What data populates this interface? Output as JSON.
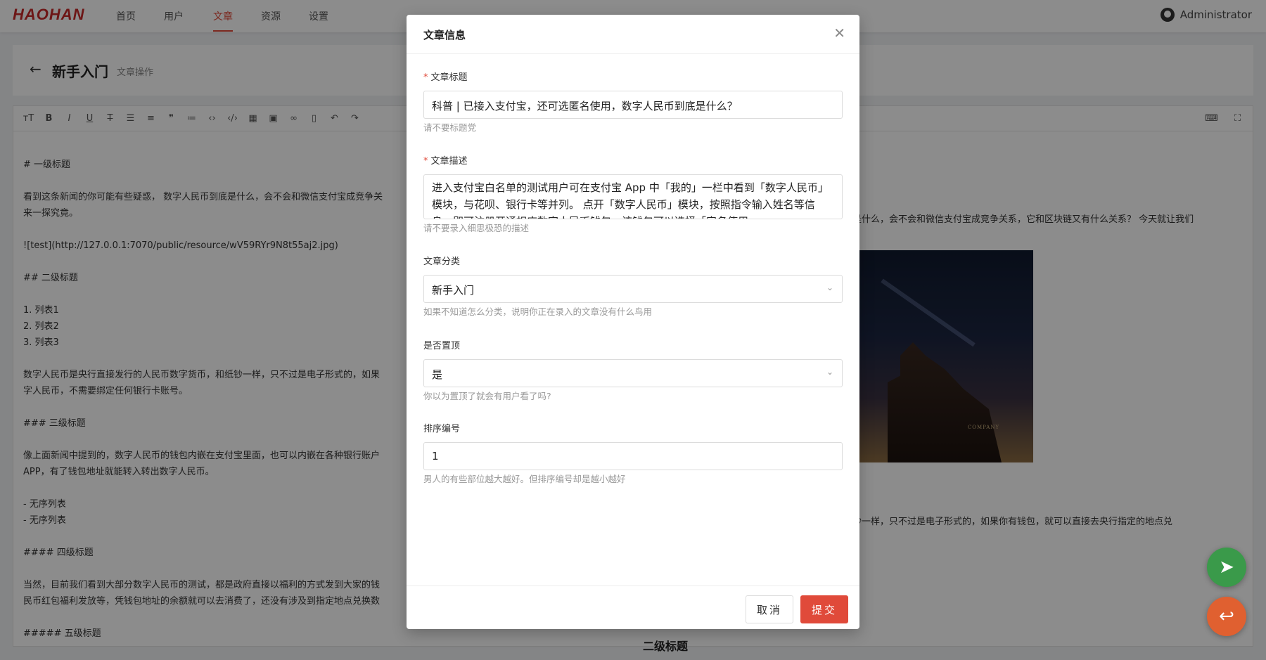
{
  "navbar": {
    "logo": "HAOHAN",
    "items": [
      {
        "label": "首页"
      },
      {
        "label": "用户"
      },
      {
        "label": "文章"
      },
      {
        "label": "资源"
      },
      {
        "label": "设置"
      }
    ],
    "active_index": 2,
    "user_name": "Administrator"
  },
  "page_header": {
    "title": "新手入门",
    "subtitle": "文章操作"
  },
  "editor": {
    "toolbar": [
      "heading-icon",
      "bold-icon",
      "italic-icon",
      "underline-icon",
      "strikethrough-icon",
      "unordered-list-icon",
      "ordered-list-icon",
      "quote-icon",
      "hr-icon",
      "code-icon",
      "code-block-icon",
      "table-icon",
      "image-icon",
      "link-icon",
      "trash-icon",
      "undo-icon",
      "redo-icon"
    ],
    "markdown_lines": [
      "# 一级标题",
      "",
      "看到这条新闻的你可能有些疑惑， 数字人民币到底是什么，会不会和微信支付宝成竞争关",
      "来一探究竟。",
      "",
      "![test](http://127.0.0.1:7070/public/resource/wV59RYr9N8t55aj2.jpg)",
      "",
      "## 二级标题",
      "",
      "1. 列表1",
      "2. 列表2",
      "3. 列表3",
      "",
      "数字人民币是央行直接发行的人民币数字货币，和纸钞一样，只不过是电子形式的，如果",
      "字人民币，不需要绑定任何银行卡账号。",
      "",
      "### 三级标题",
      "",
      "像上面新闻中提到的，数字人民币的钱包内嵌在支付宝里面，也可以内嵌在各种银行账户",
      "APP，有了钱包地址就能转入转出数字人民币。",
      "",
      "- 无序列表",
      "- 无序列表",
      "",
      "#### 四级标题",
      "",
      "当然，目前我们看到大部分数字人民币的测试，都是政府直接以福利的方式发到大家的钱",
      "民币红包福利发放等，凭钱包地址的余额就可以去消费了，还没有涉及到指定地点兑换数",
      "",
      "##### 五级标题"
    ],
    "preview_line_1": "底是什么，会不会和微信支付宝成竞争关系，它和区块链又有什么关系？ 今天就让我们",
    "preview_line_2": "纸钞一样，只不过是电子形式的，如果你有钱包，就可以直接去央行指定的地点兑",
    "preview_image_caption": "COMPANY",
    "preview_heading": "二级标题"
  },
  "modal": {
    "title": "文章信息",
    "fields": {
      "title": {
        "label": "文章标题",
        "value": "科普 | 已接入支付宝，还可选匿名使用，数字人民币到底是什么？",
        "hint": "请不要标题党"
      },
      "description": {
        "label": "文章描述",
        "value": "进入支付宝白名单的测试用户可在支付宝 App 中「我的」一栏中看到「数字人民币」模块，与花呗、银行卡等并列。 点开「数字人民币」模块，按照指令输入姓名等信息，即可注册开通相应数字人民币钱包，该钱包可以选择「实名使用」",
        "hint": "请不要录入细思极恐的描述"
      },
      "category": {
        "label": "文章分类",
        "value": "新手入门",
        "hint": "如果不知道怎么分类，说明你正在录入的文章没有什么鸟用"
      },
      "pinned": {
        "label": "是否置顶",
        "value": "是",
        "hint": "你以为置顶了就会有用户看了吗?"
      },
      "sort": {
        "label": "排序编号",
        "value": "1",
        "hint": "男人的有些部位越大越好。但排序编号却是越小越好"
      }
    },
    "cancel_label": "取消",
    "submit_label": "提交"
  },
  "colors": {
    "accent": "#e04a3a",
    "logo": "#c62828",
    "fab_send": "#3a9a4a",
    "fab_reply": "#e06030"
  }
}
